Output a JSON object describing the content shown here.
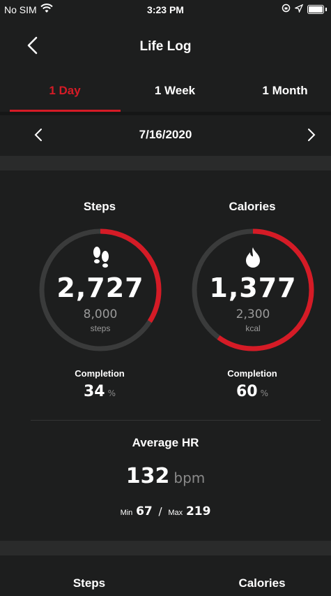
{
  "status_bar": {
    "carrier": "No SIM",
    "time": "3:23 PM"
  },
  "header": {
    "title": "Life Log"
  },
  "tabs": [
    {
      "label": "1 Day",
      "active": true
    },
    {
      "label": "1 Week",
      "active": false
    },
    {
      "label": "1 Month",
      "active": false
    }
  ],
  "date_nav": {
    "date": "7/16/2020"
  },
  "steps": {
    "title": "Steps",
    "value": "2,727",
    "goal": "8,000",
    "unit": "steps",
    "completion_label": "Completion",
    "completion": "34",
    "completion_unit": "%",
    "progress": 0.34,
    "icon": "footprints-icon"
  },
  "calories": {
    "title": "Calories",
    "value": "1,377",
    "goal": "2,300",
    "unit": "kcal",
    "completion_label": "Completion",
    "completion": "60",
    "completion_unit": "%",
    "progress": 0.6,
    "icon": "flame-icon"
  },
  "heart_rate": {
    "title": "Average HR",
    "value": "132",
    "unit": "bpm",
    "min_label": "Min",
    "min": "67",
    "separator": "/",
    "max_label": "Max",
    "max": "219"
  },
  "bottom_section": {
    "steps_title": "Steps",
    "calories_title": "Calories"
  },
  "colors": {
    "accent": "#d51b26",
    "background": "#1d1e1e",
    "ring_track": "#3a3b3b"
  }
}
